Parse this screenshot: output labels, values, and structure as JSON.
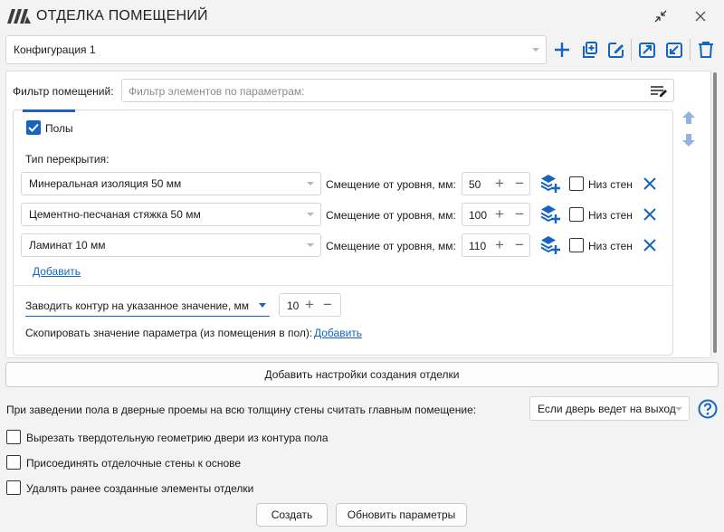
{
  "window": {
    "title": "ОТДЕЛКА ПОМЕЩЕНИЙ"
  },
  "config": {
    "selected": "Конфигурация 1"
  },
  "filter": {
    "label": "Фильтр помещений:",
    "placeholder": "Фильтр элементов по параметрам:"
  },
  "floors": {
    "checkbox_label": "Полы",
    "checked": true,
    "slab_type_label": "Тип перекрытия:",
    "offset_label": "Смещение от уровня, мм:",
    "bottom_walls_label": "Низ стен",
    "layers": [
      {
        "material": "Минеральная изоляция 50 мм",
        "offset": "50"
      },
      {
        "material": "Цементно-песчаная стяжка 50 мм",
        "offset": "100"
      },
      {
        "material": "Ламинат 10 мм",
        "offset": "110"
      }
    ],
    "add_link": "Добавить",
    "contour_mode": "Заводить контур на указанное значение, мм",
    "contour_value": "10",
    "copy_param_label": "Скопировать значение параметра (из помещения в пол):",
    "copy_param_link": "Добавить"
  },
  "add_settings_button": "Добавить настройки создания отделки",
  "door": {
    "label": "При заведении пола в дверные проемы на всю толщину стены считать главным помещение:",
    "selected": "Если дверь ведет на выход"
  },
  "options": [
    {
      "label": "Вырезать твердотельную геометрию двери из контура пола",
      "checked": false
    },
    {
      "label": "Присоединять отделочные стены к основе",
      "checked": false
    },
    {
      "label": "Удалять ранее созданные элементы отделки",
      "checked": false
    }
  ],
  "buttons": {
    "create": "Создать",
    "update": "Обновить параметры"
  },
  "colors": {
    "accent": "#1565c0",
    "logo": "#3d3d3d",
    "arrows": "#90b4dd"
  }
}
